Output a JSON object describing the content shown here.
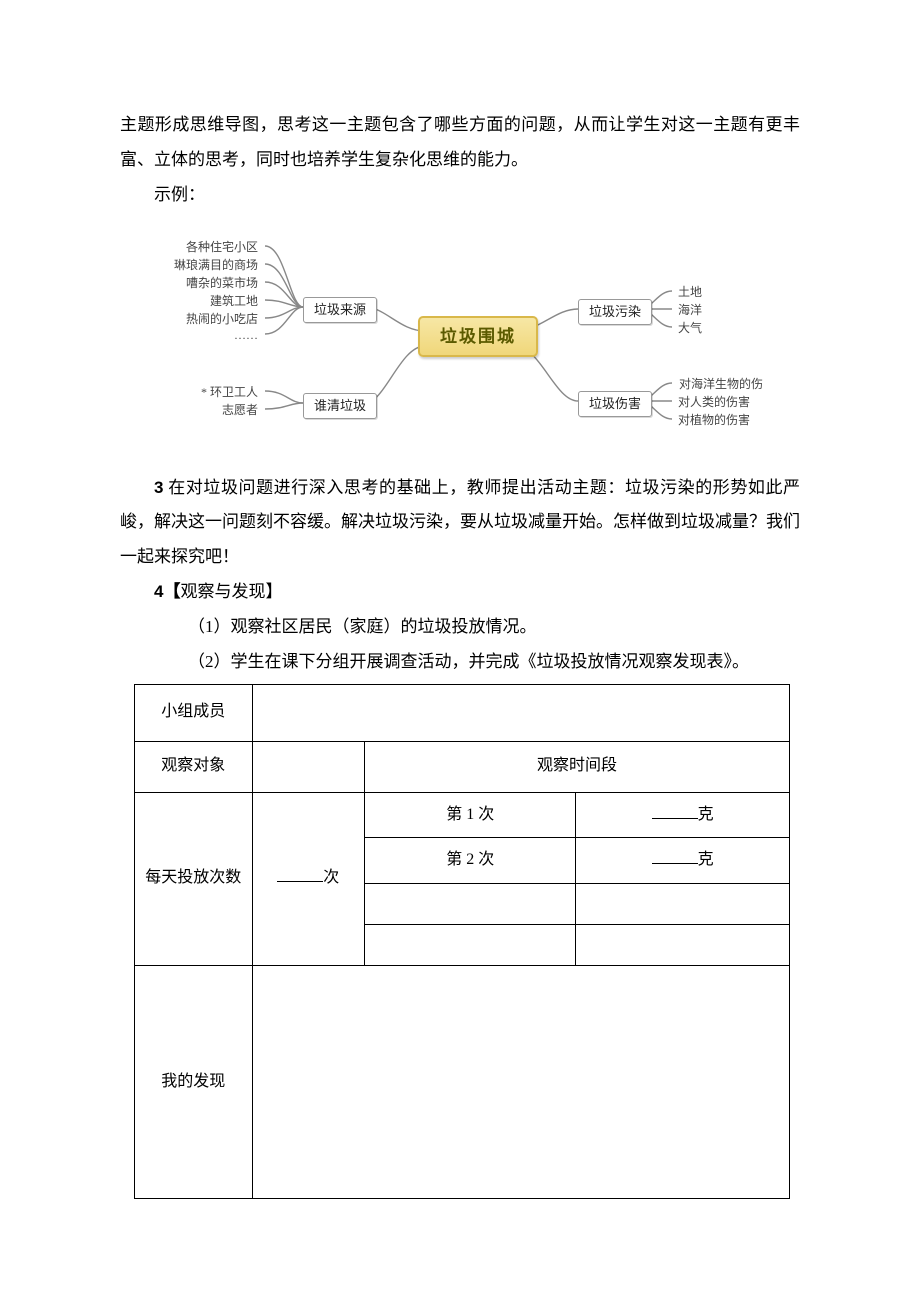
{
  "p1": "主题形成思维导图，思考这一主题包含了哪些方面的问题，从而让学生对这一主题有更丰富、立体的思考，同时也培养学生复杂化思维的能力。",
  "p2": "示例：",
  "mm": {
    "center": "垃圾围城",
    "b1_label": "垃圾来源",
    "b1_items": [
      "各种住宅小区",
      "琳琅满目的商场",
      "嘈杂的菜市场",
      "建筑工地",
      "热闹的小吃店",
      "……"
    ],
    "b2_label": "谁清垃圾",
    "b2_items": [
      "* 环卫工人",
      "志愿者"
    ],
    "b3_label": "垃圾污染",
    "b3_items": [
      "土地",
      "海洋",
      "大气"
    ],
    "b4_label": "垃圾伤害",
    "b4_items": [
      "对海洋生物的伤害",
      "对人类的伤害",
      "对植物的伤害"
    ]
  },
  "p3_num": "3",
  "p3_text": "在对垃圾问题进行深入思考的基础上，教师提出活动主题：垃圾污染的形势如此严峻，解决这一问题刻不容缓。解决垃圾污染，要从垃圾减量开始。怎样做到垃圾减量？我们一起来探究吧！",
  "p4_num": "4",
  "p4_bold": "【",
  "p4_rest": "观察与发现】",
  "p5": "（1）观察社区居民（家庭）的垃圾投放情况。",
  "p6": "（2）学生在课下分组开展调查活动，并完成《垃圾投放情况观察发现表》。",
  "table": {
    "r1c1": "小组成员",
    "r2c1": "观察对象",
    "r2c3": "观察时间段",
    "r3c1": "每天投放次数",
    "r3c2_suffix": "次",
    "r3c3a": "第 1 次",
    "r3c3b": "第 2 次",
    "r3c4_suffix": "克",
    "r4c1": "我的发现"
  }
}
